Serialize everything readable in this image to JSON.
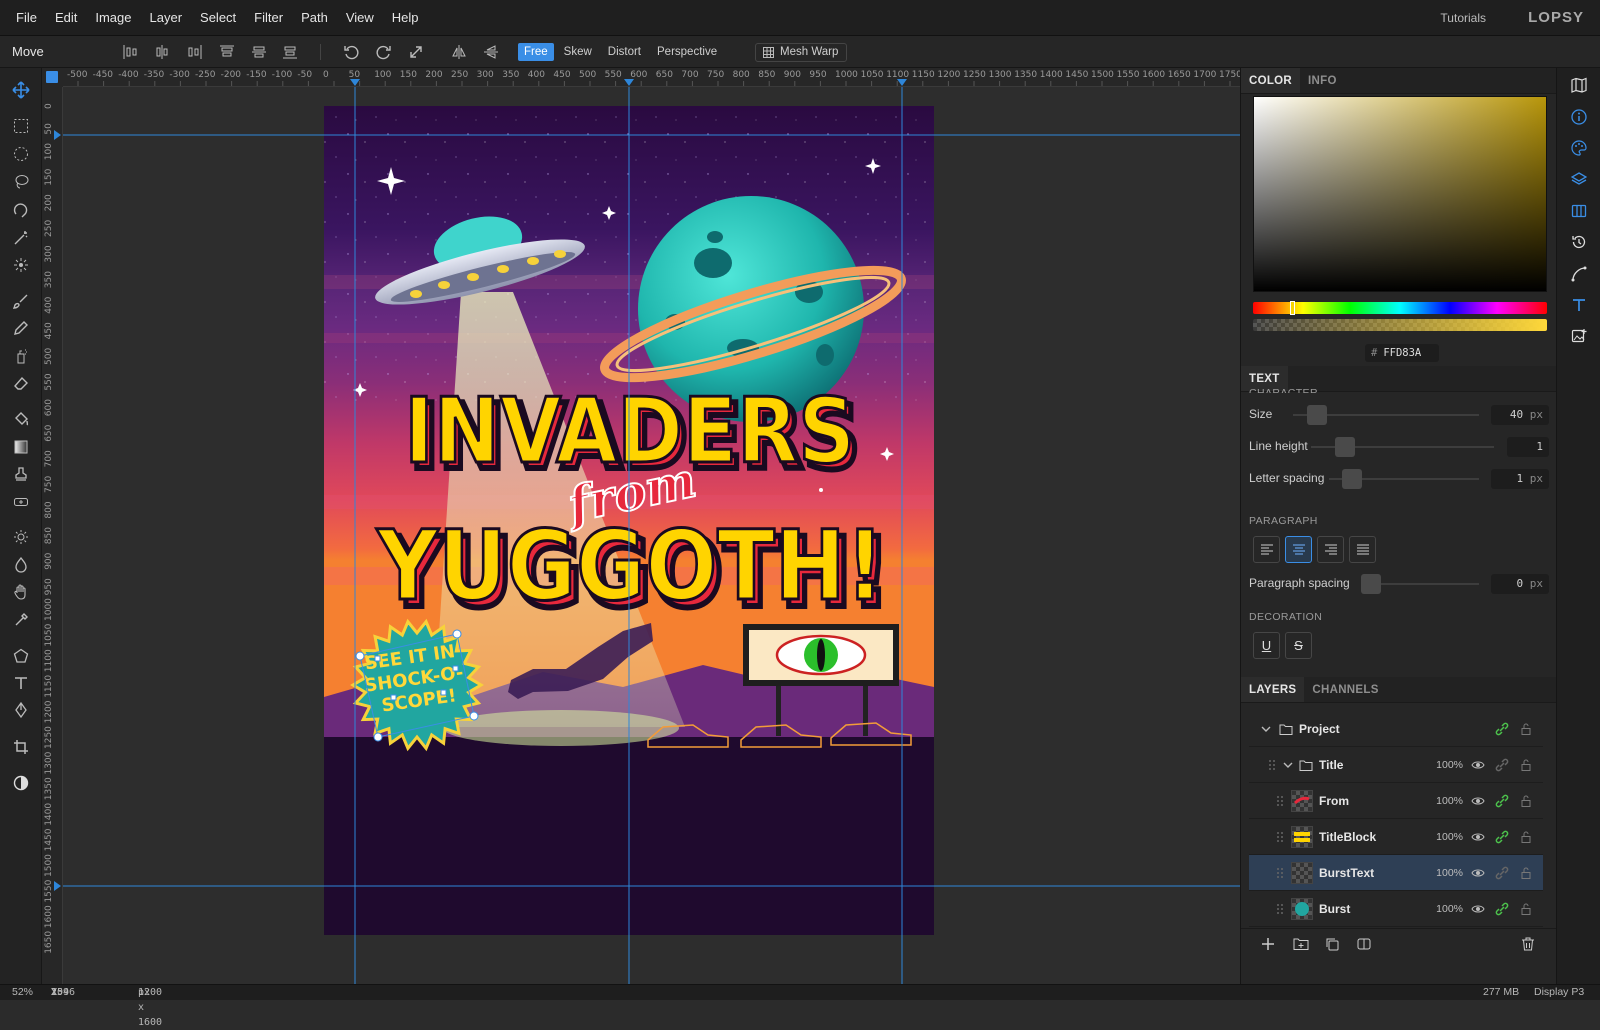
{
  "menu": [
    "File",
    "Edit",
    "Image",
    "Layer",
    "Select",
    "Filter",
    "Path",
    "View",
    "Help"
  ],
  "header": {
    "tutorials": "Tutorials",
    "brand": "LOPSY"
  },
  "options": {
    "tool_label": "Move",
    "transform_modes": [
      "Free",
      "Skew",
      "Distort",
      "Perspective"
    ],
    "active_mode": "Free",
    "mesh_warp": "Mesh Warp"
  },
  "toolbar": [
    "move-icon",
    "rect-select-icon",
    "ellipse-select-icon",
    "lasso-icon",
    "magnetic-lasso-icon",
    "magic-wand-icon",
    "quick-select-icon",
    "brush-icon",
    "pencil-icon",
    "spray-icon",
    "eraser-icon",
    "bucket-icon",
    "gradient-icon",
    "stamp-icon",
    "healing-icon",
    "dodge-icon",
    "burn-icon",
    "hand-icon",
    "eyedropper-icon",
    "polygon-icon",
    "type-icon",
    "pen-icon",
    "crop-icon",
    "contrast-icon"
  ],
  "rulers": {
    "top": [
      "-500",
      "-450",
      "-400",
      "-350",
      "-300",
      "-250",
      "-200",
      "-150",
      "-100",
      "-50",
      "0",
      "50",
      "100",
      "150",
      "200",
      "250",
      "300",
      "350",
      "400",
      "450",
      "500",
      "550",
      "600",
      "650",
      "700",
      "750",
      "800",
      "850",
      "900",
      "950",
      "1000",
      "1050",
      "1100",
      "1150",
      "1200",
      "1250",
      "1300",
      "1350",
      "1400",
      "1450",
      "1500",
      "1550",
      "1600",
      "1650",
      "1700",
      "1750"
    ],
    "left": [
      "0",
      "50",
      "100",
      "150",
      "200",
      "250",
      "300",
      "350",
      "400",
      "450",
      "500",
      "550",
      "600",
      "650",
      "700",
      "750",
      "800",
      "850",
      "900",
      "950",
      "1000",
      "1050",
      "1100",
      "1150",
      "1200",
      "1250",
      "1300",
      "1350",
      "1400",
      "1450",
      "1500",
      "1550",
      "1600",
      "1650"
    ]
  },
  "poster": {
    "title_line1": "INVADERS",
    "title_from": "from",
    "title_line2": "YUGGOTH!",
    "burst_text": [
      "SEE IT IN",
      "SHOCK-O-",
      "SCOPE!"
    ]
  },
  "panel": {
    "color_tabs": [
      "COLOR",
      "INFO"
    ],
    "hex_value": "FFD83A",
    "accent": "#3a8ee6",
    "swatch_color": "#ffd83a",
    "text_tab": "TEXT",
    "section_character": "CHARACTER",
    "size": {
      "label": "Size",
      "value": "40",
      "unit": "px"
    },
    "line_height": {
      "label": "Line height",
      "value": "1"
    },
    "letter_spacing": {
      "label": "Letter spacing",
      "value": "1",
      "unit": "px"
    },
    "section_paragraph": "PARAGRAPH",
    "paragraph_spacing": {
      "label": "Paragraph spacing",
      "value": "0",
      "unit": "px"
    },
    "section_decoration": "DECORATION",
    "decoration_buttons": [
      "U",
      "S"
    ],
    "layer_tabs": [
      "LAYERS",
      "CHANNELS"
    ],
    "layers": [
      {
        "name": "Project",
        "opacity": ""
      },
      {
        "name": "Title",
        "opacity": "100%"
      },
      {
        "name": "From",
        "opacity": "100%"
      },
      {
        "name": "TitleBlock",
        "opacity": "100%"
      },
      {
        "name": "BurstText",
        "opacity": "100%"
      },
      {
        "name": "Burst",
        "opacity": "100%"
      }
    ]
  },
  "status": {
    "zoom": "52%",
    "coords_x_label": "X:",
    "coords_x": "259",
    "coords_y_label": "Y:",
    "coords_y": "1046",
    "dims": "1200 x 1600",
    "dims_unit": "px",
    "memory": "277 MB",
    "profile": "Display P3"
  }
}
